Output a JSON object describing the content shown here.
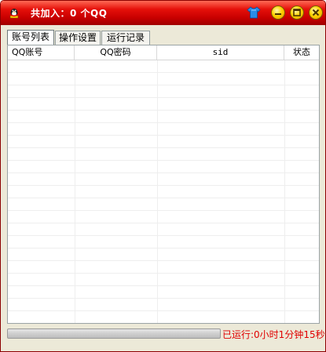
{
  "window": {
    "title": "共加入：0  个QQ",
    "accent_color": "#d40000",
    "icons": [
      "app-icon",
      "skin-icon",
      "minimize-icon",
      "maximize-icon",
      "close-icon"
    ]
  },
  "tabs": [
    {
      "label": "账号列表",
      "active": true
    },
    {
      "label": "操作设置",
      "active": false
    },
    {
      "label": "运行记录",
      "active": false
    }
  ],
  "table": {
    "columns": [
      "QQ账号",
      "QQ密码",
      "sid",
      "状态"
    ],
    "rows": []
  },
  "status": {
    "runtime": "已运行:0小时1分钟15秒",
    "progress": 0,
    "color": "#e00000"
  }
}
